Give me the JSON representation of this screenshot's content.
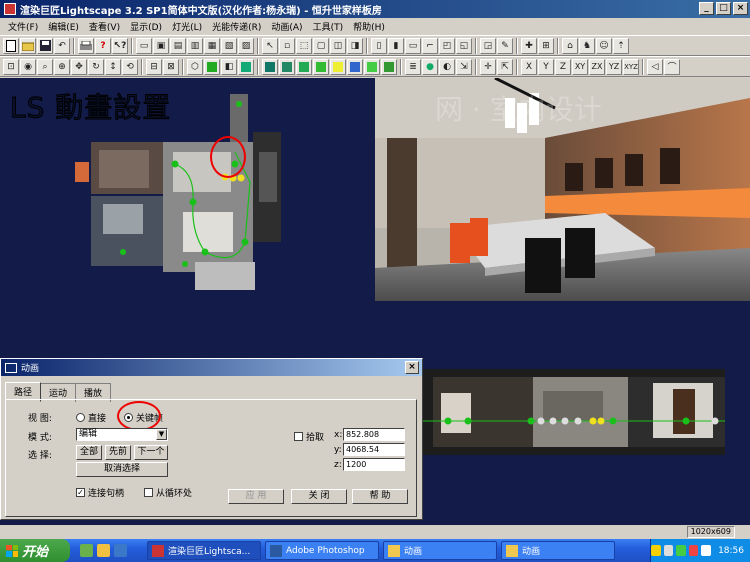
{
  "window": {
    "title": "渲染巨匠Lightscape 3.2 SP1简体中文版(汉化作者:杨永瑞) - 恒升世家样板房",
    "controls": [
      "_",
      "□",
      "×"
    ]
  },
  "menu": [
    "文件(F)",
    "编辑(E)",
    "查看(V)",
    "显示(D)",
    "灯光(L)",
    "光能传递(R)",
    "动画(A)",
    "工具(T)",
    "帮助(H)"
  ],
  "toolbar2_axes": [
    "X",
    "Y",
    "Z",
    "XY",
    "ZX",
    "YZ",
    "XYZ"
  ],
  "workspace": {
    "overlay_title": "LS 動畫設置",
    "watermark": "网 · 室内设计"
  },
  "dialog": {
    "title": "动画",
    "close": "×",
    "tabs": [
      "路径",
      "运动",
      "播放"
    ],
    "view_label": "视 图:",
    "view_options": [
      "直接",
      "关键帧"
    ],
    "mode_label": "模 式:",
    "mode_value": "编辑",
    "select_label": "选 择:",
    "btn_all": "全部",
    "btn_prev": "先前",
    "btn_next": "下一个",
    "btn_deselect": "取消选择",
    "chk_connect": "连接句柄",
    "chk_loop": "从循环处",
    "chk_pick": "拾取",
    "x_label": "x:",
    "y_label": "y:",
    "z_label": "z:",
    "x_value": "852.808",
    "y_value": "4068.54",
    "z_value": "1200",
    "btn_apply": "应 用",
    "btn_close": "关 闭",
    "btn_help": "帮 助"
  },
  "status": {
    "size": "1020x609"
  },
  "taskbar": {
    "start": "开始",
    "tasks": [
      "渲染巨匠Lightsca...",
      "Adobe Photoshop",
      "动画",
      "动画"
    ],
    "clock": "18:56"
  },
  "colors": {
    "titlebar": "#0a246a",
    "workspace_bg": "#131b48",
    "annotation": "#e00000",
    "taskbar": "#245edb"
  }
}
